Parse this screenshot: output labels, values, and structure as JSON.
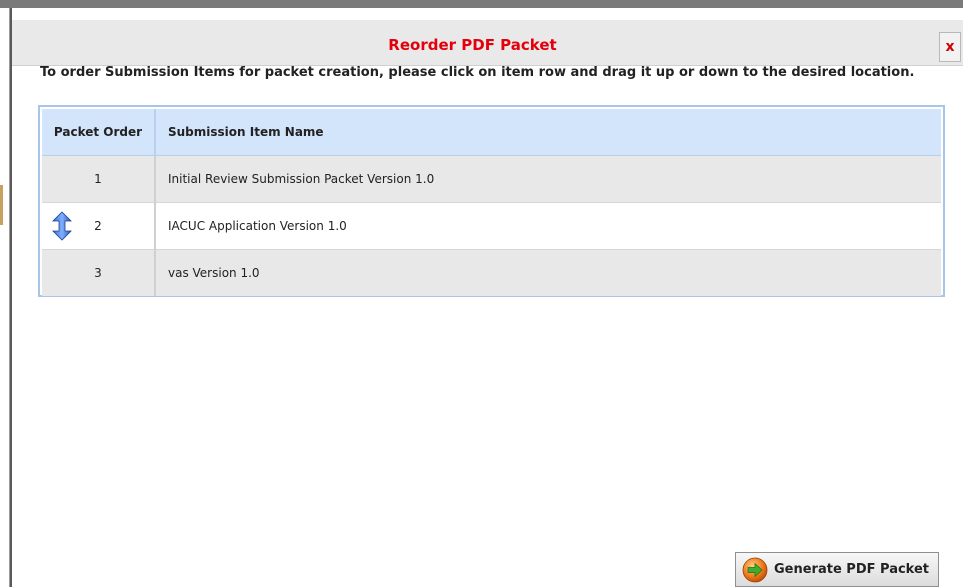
{
  "dialog": {
    "title": "Reorder PDF Packet",
    "close_label": "x",
    "instructions": "To order Submission Items for packet creation, please click on item row and drag it up or down to the desired location."
  },
  "table": {
    "headers": [
      "Packet Order",
      "Submission Item Name"
    ],
    "rows": [
      {
        "order": "1",
        "name": "Initial Review Submission Packet Version 1.0"
      },
      {
        "order": "2",
        "name": "IACUC Application Version 1.0"
      },
      {
        "order": "3",
        "name": "vas Version 1.0"
      }
    ],
    "drag_icon": "up-down-arrow-icon"
  },
  "footer": {
    "generate_label": "Generate PDF Packet",
    "generate_icon": "arrow-right-circle-icon"
  },
  "colors": {
    "title": "#e4000b",
    "header_bg": "#d3e5fb",
    "row_alt": "#e8e8e8"
  }
}
